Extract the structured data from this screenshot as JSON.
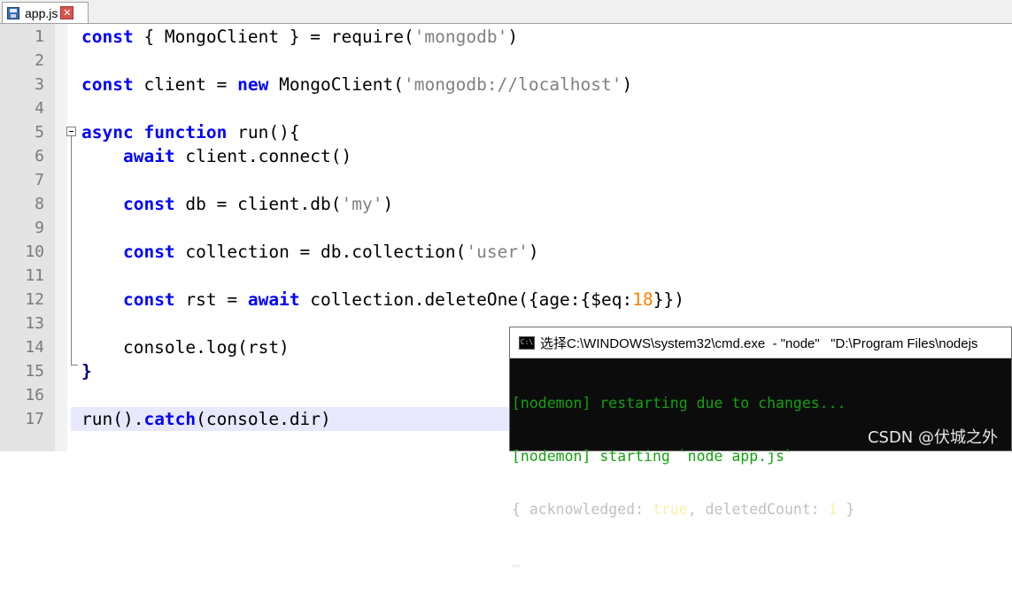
{
  "tab": {
    "label": "app.js",
    "close": "✕"
  },
  "lines": [
    {
      "n": "1"
    },
    {
      "n": "2"
    },
    {
      "n": "3"
    },
    {
      "n": "4"
    },
    {
      "n": "5"
    },
    {
      "n": "6"
    },
    {
      "n": "7"
    },
    {
      "n": "8"
    },
    {
      "n": "9"
    },
    {
      "n": "10"
    },
    {
      "n": "11"
    },
    {
      "n": "12"
    },
    {
      "n": "13"
    },
    {
      "n": "14"
    },
    {
      "n": "15"
    },
    {
      "n": "16"
    },
    {
      "n": "17"
    }
  ],
  "code": {
    "l1": [
      "const",
      " { MongoClient } = require(",
      "'mongodb'",
      ")"
    ],
    "l3": [
      "const",
      " client = ",
      "new",
      " MongoClient(",
      "'mongodb://localhost'",
      ")"
    ],
    "l5": [
      "async",
      " ",
      "function",
      " run(){"
    ],
    "l6": [
      "    ",
      "await",
      " client.connect()"
    ],
    "l8": [
      "    ",
      "const",
      " db = client.db(",
      "'my'",
      ")"
    ],
    "l10": [
      "    ",
      "const",
      " collection = db.collection(",
      "'user'",
      ")"
    ],
    "l12": [
      "    ",
      "const",
      " rst = ",
      "await",
      " collection.deleteOne({age:{$eq:",
      "18",
      "}})"
    ],
    "l14": [
      "    console.log(rst)"
    ],
    "l15": [
      "}"
    ],
    "l17": [
      "run().",
      "catch",
      "(console.dir)"
    ]
  },
  "cmd": {
    "icon": "C:\\",
    "title": "选择C:\\WINDOWS\\system32\\cmd.exe  - \"node\"   \"D:\\Program Files\\nodejs",
    "line1": "[nodemon] restarting due to changes...",
    "line2": "[nodemon] starting `node app.js`",
    "line3_a": "{ acknowledged: ",
    "line3_b": "true",
    "line3_c": ", deletedCount: ",
    "line3_d": "1",
    "line3_e": " }"
  },
  "watermark": "CSDN @伏城之外"
}
